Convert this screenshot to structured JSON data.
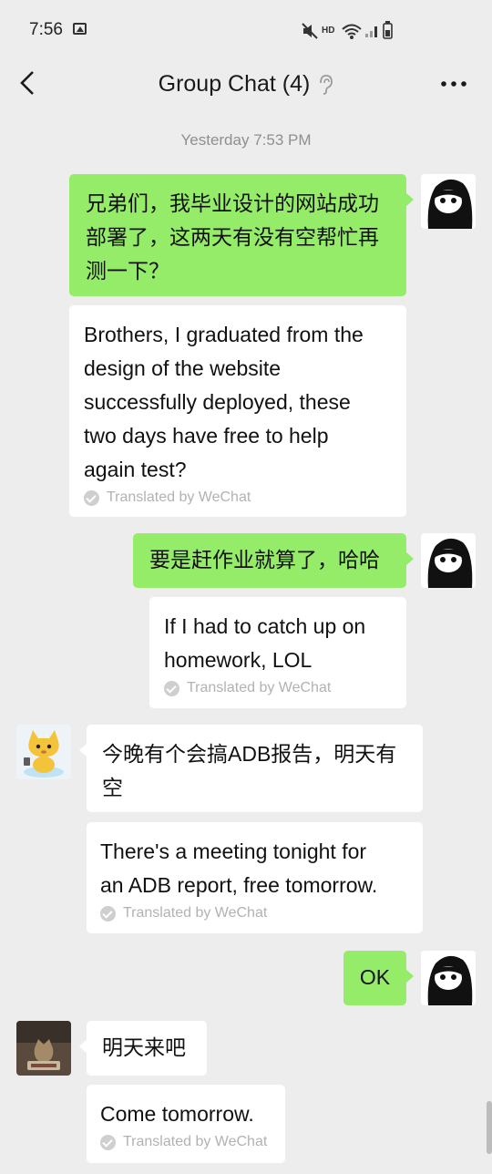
{
  "status_bar": {
    "time": "7:56",
    "hd": "HD"
  },
  "header": {
    "title": "Group Chat (4)"
  },
  "timestamp": "Yesterday 7:53 PM",
  "translation_note": "Translated by WeChat",
  "messages": [
    {
      "sender": "self",
      "original": "兄弟们，我毕业设计的网站成功部署了，这两天有没有空帮忙再测一下？",
      "original_lines": [
        "兄弟们，我毕业设计的网站成功",
        "部署了，这两天有没有空帮忙再",
        "测一下？"
      ],
      "translation_lines": [
        "Brothers, I graduated from the",
        "design of the website",
        "successfully deployed, these",
        "two days have free to help",
        "again test?"
      ]
    },
    {
      "sender": "self",
      "original_lines": [
        "要是赶作业就算了，哈哈"
      ],
      "translation_lines": [
        "If I had to catch up on",
        "homework, LOL"
      ]
    },
    {
      "sender": "friend1",
      "original_lines": [
        "今晚有个会搞ADB报告，明天有",
        "空"
      ],
      "translation_lines": [
        "There's a meeting tonight for",
        "an ADB report, free tomorrow."
      ]
    },
    {
      "sender": "self",
      "original_lines": [
        "OK"
      ]
    },
    {
      "sender": "friend2",
      "original_lines": [
        "明天来吧"
      ],
      "translation_lines": [
        "Come tomorrow."
      ]
    }
  ]
}
